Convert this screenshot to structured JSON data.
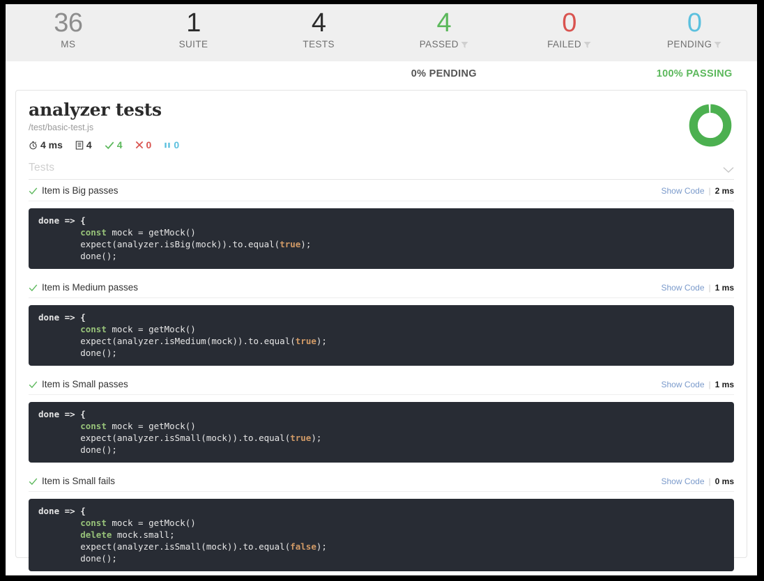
{
  "summary": {
    "stats": [
      {
        "value": "36",
        "label": "MS",
        "color_class": "muted",
        "has_filter": false
      },
      {
        "value": "1",
        "label": "SUITE",
        "color_class": "dark",
        "has_filter": false
      },
      {
        "value": "4",
        "label": "TESTS",
        "color_class": "dark",
        "has_filter": false
      },
      {
        "value": "4",
        "label": "PASSED",
        "color_class": "green",
        "has_filter": true
      },
      {
        "value": "0",
        "label": "FAILED",
        "color_class": "red",
        "has_filter": true
      },
      {
        "value": "0",
        "label": "PENDING",
        "color_class": "blue",
        "has_filter": true
      }
    ],
    "pending_percent": "0% PENDING",
    "passing_percent": "100% PASSING"
  },
  "suite": {
    "title": "analyzer tests",
    "path": "/test/basic-test.js",
    "stats": {
      "duration": "4 ms",
      "total": "4",
      "passed": "4",
      "failed": "0",
      "pending": "0"
    },
    "progress_percent": 100,
    "tests_section_label": "Tests"
  },
  "tests": [
    {
      "name": "Item is Big passes",
      "status": "passed",
      "show_code_label": "Show Code",
      "separator": "|",
      "duration": "2 ms",
      "code_lines": [
        [
          {
            "t": "done => {",
            "c": "hdr"
          }
        ],
        [
          {
            "t": "        "
          },
          {
            "t": "const",
            "c": "kw"
          },
          {
            "t": " mock = getMock()"
          }
        ],
        [
          {
            "t": "        expect(analyzer.isBig(mock)).to.equal("
          },
          {
            "t": "true",
            "c": "lit"
          },
          {
            "t": ");"
          }
        ],
        [
          {
            "t": "        done();"
          }
        ]
      ]
    },
    {
      "name": "Item is Medium passes",
      "status": "passed",
      "show_code_label": "Show Code",
      "separator": "|",
      "duration": "1 ms",
      "code_lines": [
        [
          {
            "t": "done => {",
            "c": "hdr"
          }
        ],
        [
          {
            "t": "        "
          },
          {
            "t": "const",
            "c": "kw"
          },
          {
            "t": " mock = getMock()"
          }
        ],
        [
          {
            "t": "        expect(analyzer.isMedium(mock)).to.equal("
          },
          {
            "t": "true",
            "c": "lit"
          },
          {
            "t": ");"
          }
        ],
        [
          {
            "t": "        done();"
          }
        ]
      ]
    },
    {
      "name": "Item is Small passes",
      "status": "passed",
      "show_code_label": "Show Code",
      "separator": "|",
      "duration": "1 ms",
      "code_lines": [
        [
          {
            "t": "done => {",
            "c": "hdr"
          }
        ],
        [
          {
            "t": "        "
          },
          {
            "t": "const",
            "c": "kw"
          },
          {
            "t": " mock = getMock()"
          }
        ],
        [
          {
            "t": "        expect(analyzer.isSmall(mock)).to.equal("
          },
          {
            "t": "true",
            "c": "lit"
          },
          {
            "t": ");"
          }
        ],
        [
          {
            "t": "        done();"
          }
        ]
      ]
    },
    {
      "name": "Item is Small fails",
      "status": "passed",
      "show_code_label": "Show Code",
      "separator": "|",
      "duration": "0 ms",
      "code_lines": [
        [
          {
            "t": "done => {",
            "c": "hdr"
          }
        ],
        [
          {
            "t": "        "
          },
          {
            "t": "const",
            "c": "kw"
          },
          {
            "t": " mock = getMock()"
          }
        ],
        [
          {
            "t": "        "
          },
          {
            "t": "delete",
            "c": "kw"
          },
          {
            "t": " mock.small;"
          }
        ],
        [
          {
            "t": "        expect(analyzer.isSmall(mock)).to.equal("
          },
          {
            "t": "false",
            "c": "lit"
          },
          {
            "t": ");"
          }
        ],
        [
          {
            "t": "        done();"
          }
        ]
      ]
    }
  ],
  "colors": {
    "pass_green": "#5cb85c",
    "fail_red": "#d9534f",
    "pending_blue": "#5bc0de",
    "code_bg": "#282c34",
    "link_blue": "#7a9acb",
    "bar_bg": "#efefef"
  }
}
